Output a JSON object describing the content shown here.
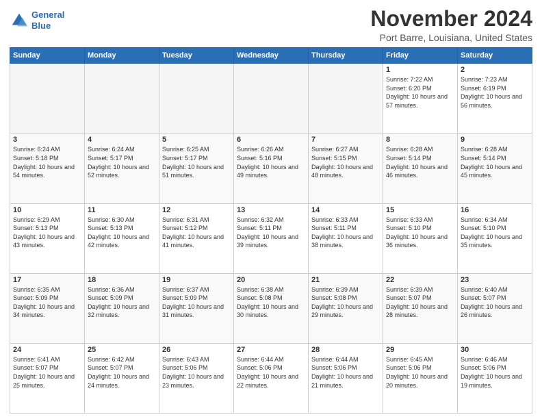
{
  "header": {
    "logo_line1": "General",
    "logo_line2": "Blue",
    "month": "November 2024",
    "location": "Port Barre, Louisiana, United States"
  },
  "weekdays": [
    "Sunday",
    "Monday",
    "Tuesday",
    "Wednesday",
    "Thursday",
    "Friday",
    "Saturday"
  ],
  "weeks": [
    [
      {
        "day": "",
        "info": ""
      },
      {
        "day": "",
        "info": ""
      },
      {
        "day": "",
        "info": ""
      },
      {
        "day": "",
        "info": ""
      },
      {
        "day": "",
        "info": ""
      },
      {
        "day": "1",
        "info": "Sunrise: 7:22 AM\nSunset: 6:20 PM\nDaylight: 10 hours and 57 minutes."
      },
      {
        "day": "2",
        "info": "Sunrise: 7:23 AM\nSunset: 6:19 PM\nDaylight: 10 hours and 56 minutes."
      }
    ],
    [
      {
        "day": "3",
        "info": "Sunrise: 6:24 AM\nSunset: 5:18 PM\nDaylight: 10 hours and 54 minutes."
      },
      {
        "day": "4",
        "info": "Sunrise: 6:24 AM\nSunset: 5:17 PM\nDaylight: 10 hours and 52 minutes."
      },
      {
        "day": "5",
        "info": "Sunrise: 6:25 AM\nSunset: 5:17 PM\nDaylight: 10 hours and 51 minutes."
      },
      {
        "day": "6",
        "info": "Sunrise: 6:26 AM\nSunset: 5:16 PM\nDaylight: 10 hours and 49 minutes."
      },
      {
        "day": "7",
        "info": "Sunrise: 6:27 AM\nSunset: 5:15 PM\nDaylight: 10 hours and 48 minutes."
      },
      {
        "day": "8",
        "info": "Sunrise: 6:28 AM\nSunset: 5:14 PM\nDaylight: 10 hours and 46 minutes."
      },
      {
        "day": "9",
        "info": "Sunrise: 6:28 AM\nSunset: 5:14 PM\nDaylight: 10 hours and 45 minutes."
      }
    ],
    [
      {
        "day": "10",
        "info": "Sunrise: 6:29 AM\nSunset: 5:13 PM\nDaylight: 10 hours and 43 minutes."
      },
      {
        "day": "11",
        "info": "Sunrise: 6:30 AM\nSunset: 5:13 PM\nDaylight: 10 hours and 42 minutes."
      },
      {
        "day": "12",
        "info": "Sunrise: 6:31 AM\nSunset: 5:12 PM\nDaylight: 10 hours and 41 minutes."
      },
      {
        "day": "13",
        "info": "Sunrise: 6:32 AM\nSunset: 5:11 PM\nDaylight: 10 hours and 39 minutes."
      },
      {
        "day": "14",
        "info": "Sunrise: 6:33 AM\nSunset: 5:11 PM\nDaylight: 10 hours and 38 minutes."
      },
      {
        "day": "15",
        "info": "Sunrise: 6:33 AM\nSunset: 5:10 PM\nDaylight: 10 hours and 36 minutes."
      },
      {
        "day": "16",
        "info": "Sunrise: 6:34 AM\nSunset: 5:10 PM\nDaylight: 10 hours and 35 minutes."
      }
    ],
    [
      {
        "day": "17",
        "info": "Sunrise: 6:35 AM\nSunset: 5:09 PM\nDaylight: 10 hours and 34 minutes."
      },
      {
        "day": "18",
        "info": "Sunrise: 6:36 AM\nSunset: 5:09 PM\nDaylight: 10 hours and 32 minutes."
      },
      {
        "day": "19",
        "info": "Sunrise: 6:37 AM\nSunset: 5:09 PM\nDaylight: 10 hours and 31 minutes."
      },
      {
        "day": "20",
        "info": "Sunrise: 6:38 AM\nSunset: 5:08 PM\nDaylight: 10 hours and 30 minutes."
      },
      {
        "day": "21",
        "info": "Sunrise: 6:39 AM\nSunset: 5:08 PM\nDaylight: 10 hours and 29 minutes."
      },
      {
        "day": "22",
        "info": "Sunrise: 6:39 AM\nSunset: 5:07 PM\nDaylight: 10 hours and 28 minutes."
      },
      {
        "day": "23",
        "info": "Sunrise: 6:40 AM\nSunset: 5:07 PM\nDaylight: 10 hours and 26 minutes."
      }
    ],
    [
      {
        "day": "24",
        "info": "Sunrise: 6:41 AM\nSunset: 5:07 PM\nDaylight: 10 hours and 25 minutes."
      },
      {
        "day": "25",
        "info": "Sunrise: 6:42 AM\nSunset: 5:07 PM\nDaylight: 10 hours and 24 minutes."
      },
      {
        "day": "26",
        "info": "Sunrise: 6:43 AM\nSunset: 5:06 PM\nDaylight: 10 hours and 23 minutes."
      },
      {
        "day": "27",
        "info": "Sunrise: 6:44 AM\nSunset: 5:06 PM\nDaylight: 10 hours and 22 minutes."
      },
      {
        "day": "28",
        "info": "Sunrise: 6:44 AM\nSunset: 5:06 PM\nDaylight: 10 hours and 21 minutes."
      },
      {
        "day": "29",
        "info": "Sunrise: 6:45 AM\nSunset: 5:06 PM\nDaylight: 10 hours and 20 minutes."
      },
      {
        "day": "30",
        "info": "Sunrise: 6:46 AM\nSunset: 5:06 PM\nDaylight: 10 hours and 19 minutes."
      }
    ]
  ]
}
